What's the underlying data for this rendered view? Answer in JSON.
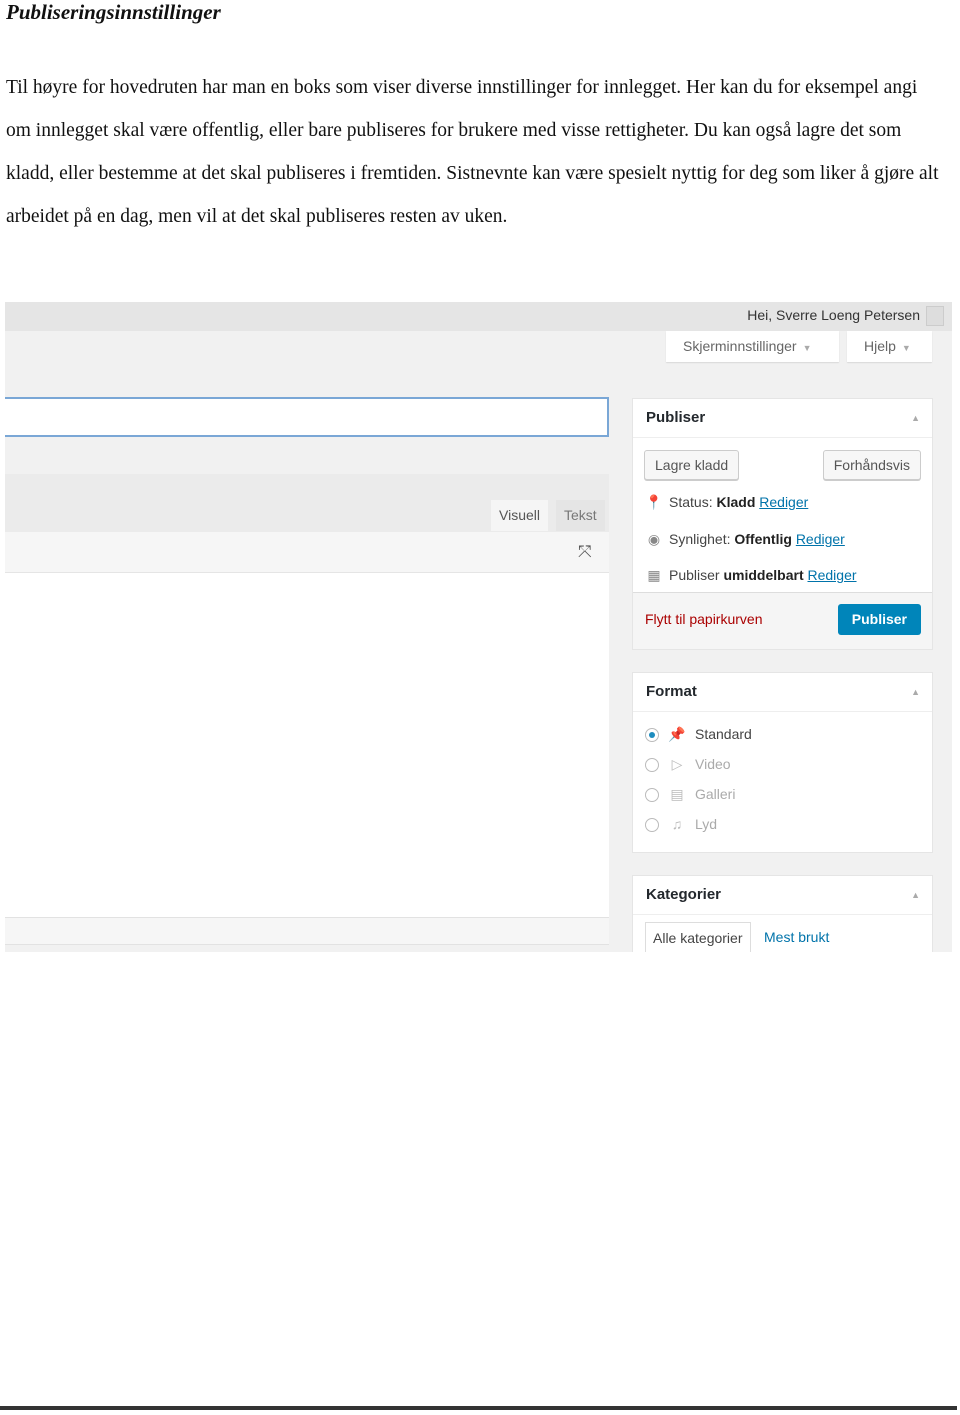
{
  "heading": "Publiseringsinnstillinger",
  "paragraph": "Til høyre for hovedruten har man en boks som viser diverse innstillinger for innlegget. Her kan du for eksempel angi om innlegget skal være offentlig, eller bare publiseres for brukere med visse rettigheter. Du kan også lagre det som kladd, eller bestemme at det skal publiseres i fremtiden. Sistnevnte kan være spesielt nyttig for deg som liker å gjøre alt arbeidet på en dag, men vil at det skal publiseres resten av uken.",
  "screenshot": {
    "greeting": "Hei, Sverre Loeng Petersen",
    "screen_options": "Skjerminnstillinger",
    "help": "Hjelp",
    "editor_tabs": [
      "Visuell",
      "Tekst"
    ],
    "publish_box": {
      "title": "Publiser",
      "save_draft": "Lagre kladd",
      "preview": "Forhåndsvis",
      "status_label": "Status:",
      "status_value": "Kladd",
      "visibility_label": "Synlighet:",
      "visibility_value": "Offentlig",
      "schedule_label": "Publiser",
      "schedule_value": "umiddelbart",
      "edit": "Rediger",
      "trash": "Flytt til papirkurven",
      "publish": "Publiser",
      "accent": "#0085ba"
    },
    "format_box": {
      "title": "Format",
      "options": [
        {
          "label": "Standard",
          "icon": "pin-icon",
          "selected": true
        },
        {
          "label": "Video",
          "icon": "video-icon",
          "selected": false
        },
        {
          "label": "Galleri",
          "icon": "gallery-icon",
          "selected": false
        },
        {
          "label": "Lyd",
          "icon": "audio-icon",
          "selected": false
        }
      ]
    },
    "categories_box": {
      "title": "Kategorier",
      "tabs": [
        "Alle kategorier",
        "Mest brukt"
      ]
    }
  }
}
